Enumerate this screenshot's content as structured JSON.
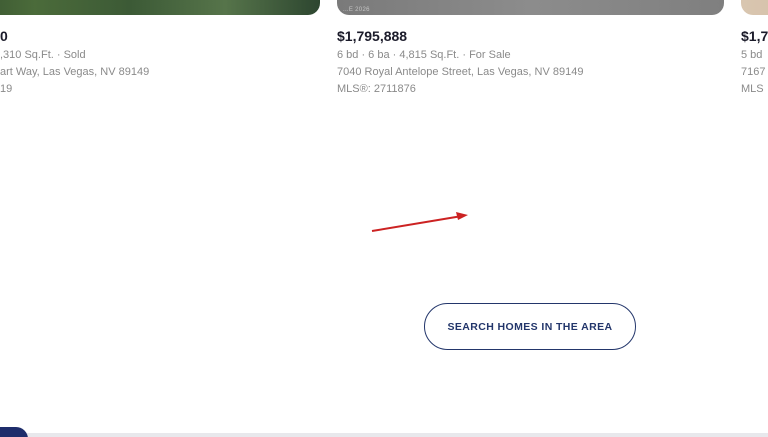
{
  "listings": [
    {
      "price": "0",
      "meta": ",310 Sq.Ft. · Sold",
      "address": "art Way, Las Vegas, NV 89149",
      "mls": "19"
    },
    {
      "price": "$1,795,888",
      "meta": "6 bd · 6 ba · 4,815 Sq.Ft. · For Sale",
      "address": "7040 Royal Antelope Street, Las Vegas, NV 89149",
      "mls": "MLS®: 2711876",
      "watermark": "...E 2026"
    },
    {
      "price": "$1,7",
      "meta": "5 bd",
      "address": "7167",
      "mls": "MLS"
    }
  ],
  "annotation": {
    "arrow_color": "#cc2222"
  },
  "cta": {
    "label": "SEARCH HOMES IN THE AREA"
  },
  "colors": {
    "accent": "#23366b",
    "price_text": "#1b1b2a",
    "meta_text": "#8a8a8a"
  }
}
